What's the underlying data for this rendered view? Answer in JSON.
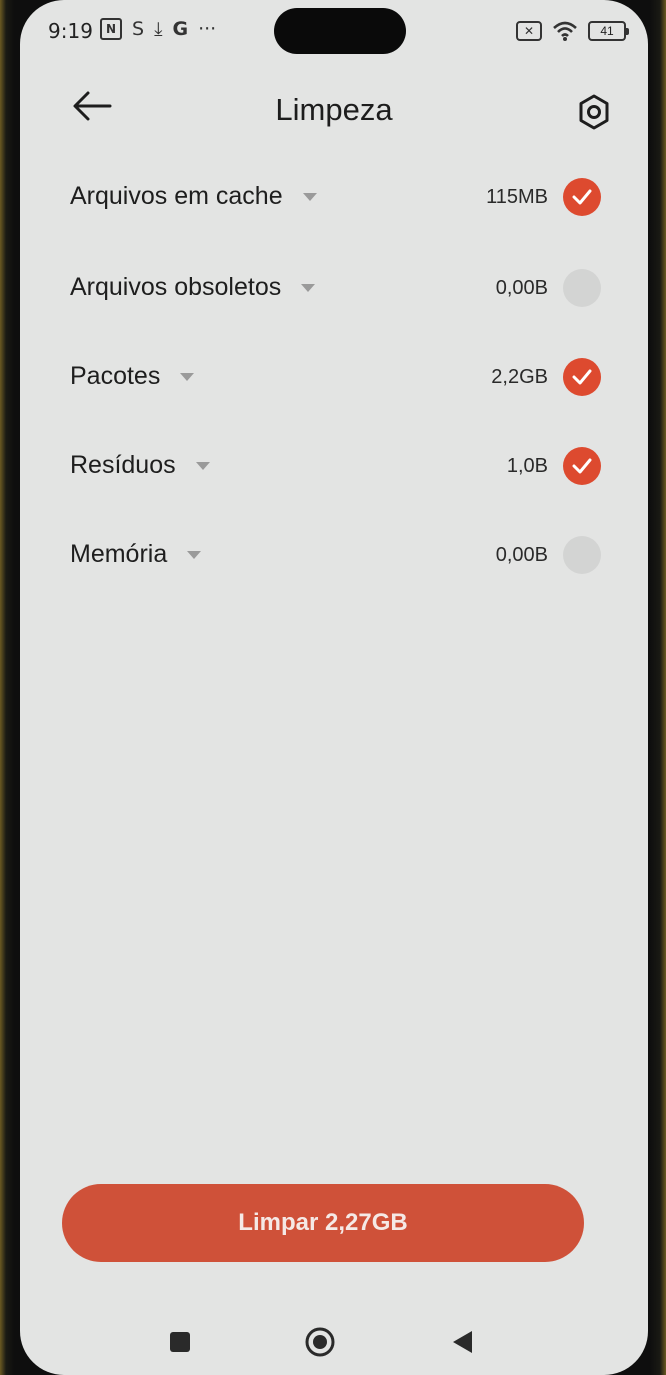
{
  "status_bar": {
    "time": "9:19",
    "left_icons": [
      "nfc-icon",
      "sync-icon",
      "download-icon",
      "google-icon",
      "more-icon"
    ],
    "nfc_glyph": "N",
    "sync_glyph": "S",
    "download_glyph": "⤓",
    "google_glyph": "G",
    "more_glyph": "···",
    "sim_glyph": "✕",
    "battery_level": "41"
  },
  "header": {
    "title": "Limpeza",
    "back_icon": "arrow-left-icon",
    "settings_icon": "hexagon-settings-icon"
  },
  "items": [
    {
      "label": "Arquivos em cache",
      "size": "115MB",
      "checked": true
    },
    {
      "label": "Arquivos obsoletos",
      "size": "0,00B",
      "checked": false
    },
    {
      "label": "Pacotes",
      "size": "2,2GB",
      "checked": true
    },
    {
      "label": "Resíduos",
      "size": "1,0B",
      "checked": true
    },
    {
      "label": "Memória",
      "size": "0,00B",
      "checked": false
    }
  ],
  "action": {
    "clean_label": "Limpar 2,27GB"
  },
  "nav": {
    "recent_icon": "square-icon",
    "home_icon": "circle-home-icon",
    "back_icon": "triangle-back-icon"
  },
  "colors": {
    "accent": "#dd4a2f",
    "button": "#cf5139",
    "background": "#e3e4e3"
  }
}
